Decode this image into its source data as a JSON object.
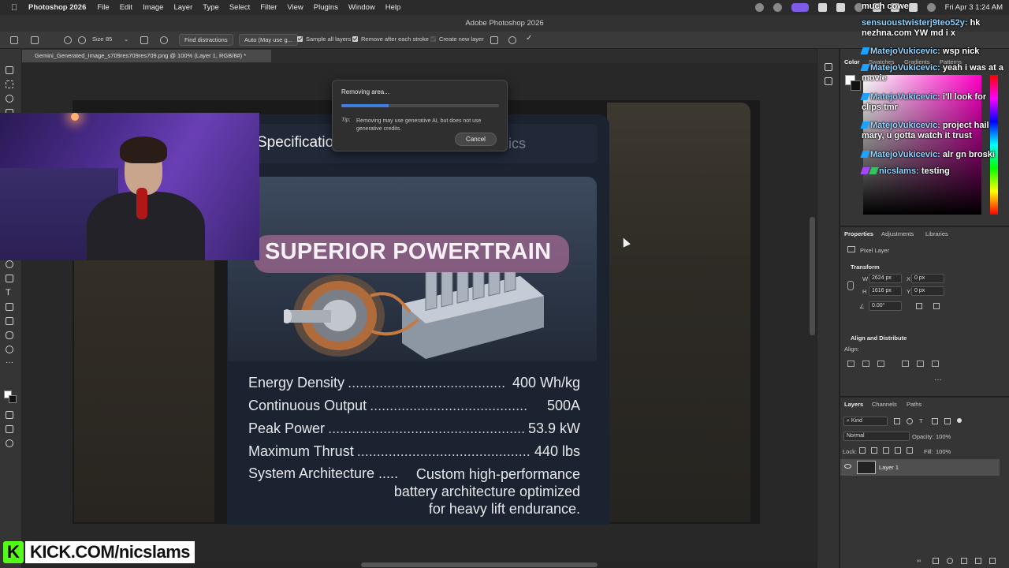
{
  "menubar": {
    "app_name": "Photoshop 2026",
    "items": [
      "File",
      "Edit",
      "Image",
      "Layer",
      "Type",
      "Select",
      "Filter",
      "View",
      "Plugins",
      "Window",
      "Help"
    ],
    "clock": "Fri Apr 3  1:24 AM"
  },
  "window": {
    "title": "Adobe Photoshop 2026"
  },
  "options": {
    "size_label": "Size",
    "size_value": "85",
    "find_distractions": "Find distractions",
    "mode_select": "Auto (May use g...",
    "sample_all_layers": "Sample all layers",
    "remove_after_stroke": "Remove after each stroke",
    "create_new_layer": "Create new layer"
  },
  "document": {
    "tab_title": "Gemini_Generated_Image_s709res709res709.png @ 100% (Layer 1, RGB/8#) *"
  },
  "canvas": {
    "tab_active": "Specificatio",
    "tab_other": "ics",
    "hero_title": "SUPERIOR POWERTRAIN",
    "specs": [
      {
        "key": "Energy Density",
        "dots": "........................................",
        "value": "400 Wh/kg"
      },
      {
        "key": "Continuous Output",
        "dots": "........................................",
        "value": "500A"
      },
      {
        "key": "Peak Power",
        "dots": "..................................................",
        "value": "53.9 kW"
      },
      {
        "key": "Maximum Thrust",
        "dots": "............................................",
        "value": "440 lbs"
      }
    ],
    "system_key": "System Architecture .....",
    "system_value_1": "Custom high-performance",
    "system_value_2": "battery architecture optimized",
    "system_value_3": "for heavy lift endurance."
  },
  "dialog": {
    "title": "Removing area...",
    "progress": 0.3,
    "tip_label": "Tip:",
    "tip_text": "Removing may use generative AI, but does not use generative credits.",
    "cancel": "Cancel"
  },
  "color_panel": {
    "tabs": [
      "Color",
      "Swatches",
      "Gradients",
      "Patterns"
    ]
  },
  "properties": {
    "tabs": [
      "Properties",
      "Adjustments",
      "Libraries"
    ],
    "kind": "Pixel Layer",
    "transform_label": "Transform",
    "w_label": "W",
    "w_value": "2624 px",
    "x_label": "X",
    "x_value": "0 px",
    "h_label": "H",
    "h_value": "1616 px",
    "y_label": "Y",
    "y_value": "0 px",
    "angle": "0.00°",
    "align_label": "Align and Distribute",
    "align_sub": "Align:"
  },
  "layers": {
    "tabs": [
      "Layers",
      "Channels",
      "Paths"
    ],
    "kind_filter": "Kind",
    "blend_mode": "Normal",
    "opacity_label": "Opacity:",
    "opacity_value": "100%",
    "lock_label": "Lock:",
    "fill_label": "Fill:",
    "fill_value": "100%",
    "layer_name": "Layer 1"
  },
  "chat": [
    {
      "name": "",
      "text": "much cowe"
    },
    {
      "name": "sensuoustwisterj9teo52y:",
      "text": "hk nezhna.com YW md i x"
    },
    {
      "name": "MatejoVukicevic:",
      "text": "wsp nick"
    },
    {
      "name": "MatejoVukicevic:",
      "text": "yeah i was at a movie"
    },
    {
      "name": "MatejoVukicevic:",
      "text": "i'll look for clips tmr"
    },
    {
      "name": "MatejoVukicevic:",
      "text": "project hail mary, u gotta watch it trust"
    },
    {
      "name": "MatejoVukicevic:",
      "text": "alr gn broski"
    },
    {
      "name": "nicslams:",
      "text": "testing"
    }
  ],
  "watermark": {
    "logo": "K",
    "text": "KICK.COM/nicslams"
  }
}
